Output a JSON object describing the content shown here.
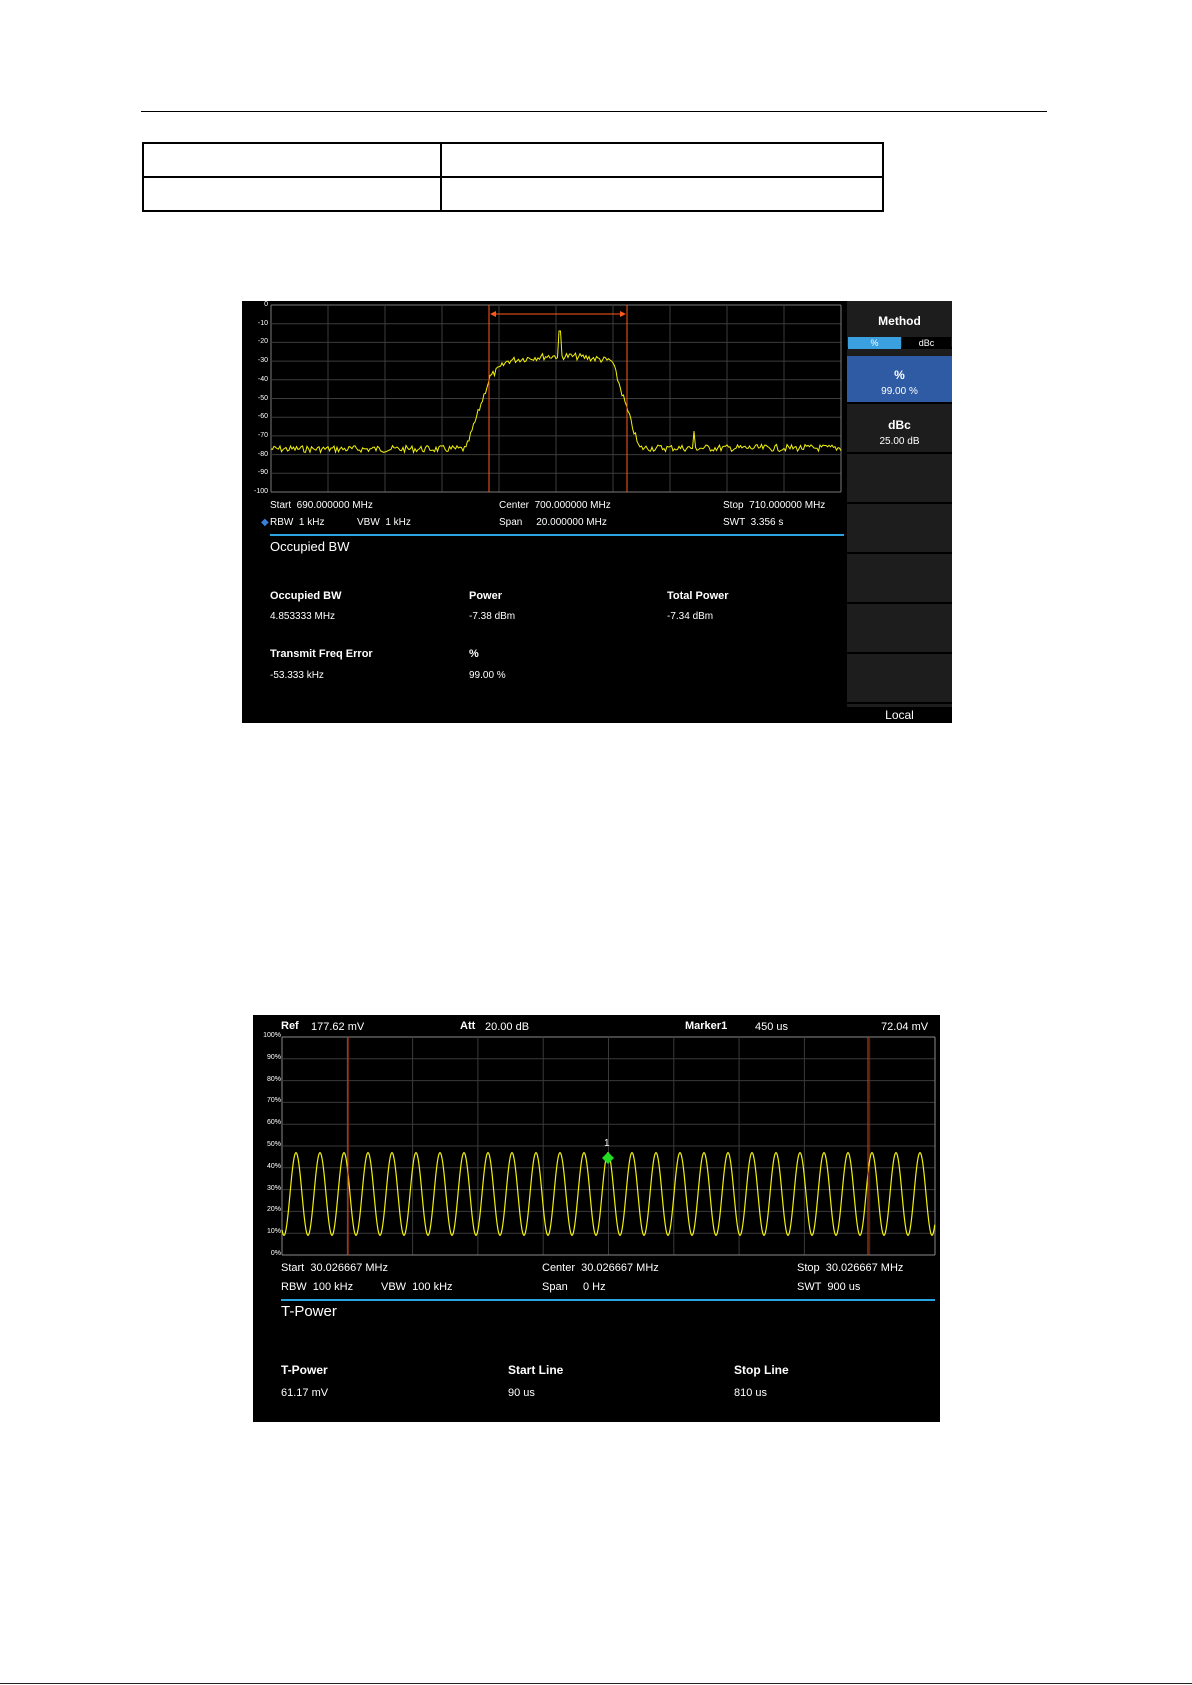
{
  "screen1": {
    "y_ticks": [
      "0",
      "-10",
      "-20",
      "-30",
      "-40",
      "-50",
      "-60",
      "-70",
      "-80",
      "-90",
      "-100"
    ],
    "info": {
      "start": "Start  690.000000 MHz",
      "center": "Center  700.000000 MHz",
      "stop": "Stop  710.000000 MHz",
      "rbw": "RBW  1 kHz",
      "vbw": "VBW  1 kHz",
      "span": "Span     20.000000 MHz",
      "swt": "SWT  3.356 s"
    },
    "title": "Occupied BW",
    "results": [
      {
        "label": "Occupied BW",
        "value": "4.853333 MHz"
      },
      {
        "label": "Power",
        "value": "-7.38 dBm"
      },
      {
        "label": "Total Power",
        "value": "-7.34 dBm"
      },
      {
        "label": "Transmit Freq Error",
        "value": "-53.333 kHz"
      },
      {
        "label": "%",
        "value": "99.00 %"
      }
    ],
    "menu": {
      "method": "Method",
      "seg_pct": "%",
      "seg_dbc": "dBc",
      "pct_label": "%",
      "pct_value": "99.00 %",
      "dbc_label": "dBc",
      "dbc_value": "25.00 dB",
      "local": "Local"
    },
    "colors": {
      "trace": "#f2f20a",
      "markers": "#ff5a1a",
      "accent": "#29a4e0",
      "active_btn": "#2e5ba4"
    }
  },
  "screen2": {
    "top": {
      "ref_label": "Ref",
      "ref_value": "177.62 mV",
      "att_label": "Att",
      "att_value": "20.00 dB",
      "marker_label": "Marker1",
      "marker_time": "450 us",
      "marker_value": "72.04 mV"
    },
    "y_ticks": [
      "100%",
      "90%",
      "80%",
      "70%",
      "60%",
      "50%",
      "40%",
      "30%",
      "20%",
      "10%",
      "0%"
    ],
    "marker_number": "1",
    "info": {
      "start": "Start  30.026667 MHz",
      "center": "Center  30.026667 MHz",
      "stop": "Stop  30.026667 MHz",
      "rbw": "RBW  100 kHz",
      "vbw": "VBW  100 kHz",
      "span": "Span     0 Hz",
      "swt": "SWT  900 us"
    },
    "title": "T-Power",
    "results": [
      {
        "label": "T-Power",
        "value": "61.17 mV"
      },
      {
        "label": "Start Line",
        "value": "90 us"
      },
      {
        "label": "Stop Line",
        "value": "810 us"
      }
    ],
    "colors": {
      "trace": "#f2f20a",
      "lines": "#d9441a",
      "marker": "#22dd22"
    }
  }
}
